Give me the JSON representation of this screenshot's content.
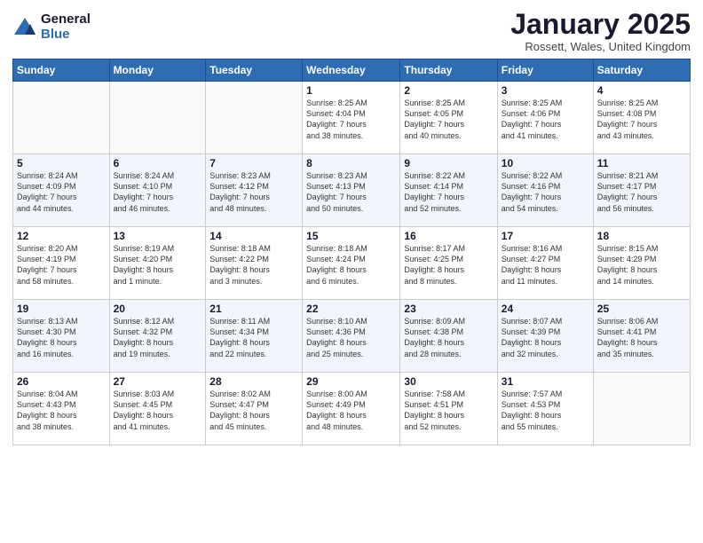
{
  "logo": {
    "general": "General",
    "blue": "Blue"
  },
  "title": "January 2025",
  "location": "Rossett, Wales, United Kingdom",
  "days_of_week": [
    "Sunday",
    "Monday",
    "Tuesday",
    "Wednesday",
    "Thursday",
    "Friday",
    "Saturday"
  ],
  "weeks": [
    [
      {
        "day": "",
        "info": ""
      },
      {
        "day": "",
        "info": ""
      },
      {
        "day": "",
        "info": ""
      },
      {
        "day": "1",
        "info": "Sunrise: 8:25 AM\nSunset: 4:04 PM\nDaylight: 7 hours\nand 38 minutes."
      },
      {
        "day": "2",
        "info": "Sunrise: 8:25 AM\nSunset: 4:05 PM\nDaylight: 7 hours\nand 40 minutes."
      },
      {
        "day": "3",
        "info": "Sunrise: 8:25 AM\nSunset: 4:06 PM\nDaylight: 7 hours\nand 41 minutes."
      },
      {
        "day": "4",
        "info": "Sunrise: 8:25 AM\nSunset: 4:08 PM\nDaylight: 7 hours\nand 43 minutes."
      }
    ],
    [
      {
        "day": "5",
        "info": "Sunrise: 8:24 AM\nSunset: 4:09 PM\nDaylight: 7 hours\nand 44 minutes."
      },
      {
        "day": "6",
        "info": "Sunrise: 8:24 AM\nSunset: 4:10 PM\nDaylight: 7 hours\nand 46 minutes."
      },
      {
        "day": "7",
        "info": "Sunrise: 8:23 AM\nSunset: 4:12 PM\nDaylight: 7 hours\nand 48 minutes."
      },
      {
        "day": "8",
        "info": "Sunrise: 8:23 AM\nSunset: 4:13 PM\nDaylight: 7 hours\nand 50 minutes."
      },
      {
        "day": "9",
        "info": "Sunrise: 8:22 AM\nSunset: 4:14 PM\nDaylight: 7 hours\nand 52 minutes."
      },
      {
        "day": "10",
        "info": "Sunrise: 8:22 AM\nSunset: 4:16 PM\nDaylight: 7 hours\nand 54 minutes."
      },
      {
        "day": "11",
        "info": "Sunrise: 8:21 AM\nSunset: 4:17 PM\nDaylight: 7 hours\nand 56 minutes."
      }
    ],
    [
      {
        "day": "12",
        "info": "Sunrise: 8:20 AM\nSunset: 4:19 PM\nDaylight: 7 hours\nand 58 minutes."
      },
      {
        "day": "13",
        "info": "Sunrise: 8:19 AM\nSunset: 4:20 PM\nDaylight: 8 hours\nand 1 minute."
      },
      {
        "day": "14",
        "info": "Sunrise: 8:18 AM\nSunset: 4:22 PM\nDaylight: 8 hours\nand 3 minutes."
      },
      {
        "day": "15",
        "info": "Sunrise: 8:18 AM\nSunset: 4:24 PM\nDaylight: 8 hours\nand 6 minutes."
      },
      {
        "day": "16",
        "info": "Sunrise: 8:17 AM\nSunset: 4:25 PM\nDaylight: 8 hours\nand 8 minutes."
      },
      {
        "day": "17",
        "info": "Sunrise: 8:16 AM\nSunset: 4:27 PM\nDaylight: 8 hours\nand 11 minutes."
      },
      {
        "day": "18",
        "info": "Sunrise: 8:15 AM\nSunset: 4:29 PM\nDaylight: 8 hours\nand 14 minutes."
      }
    ],
    [
      {
        "day": "19",
        "info": "Sunrise: 8:13 AM\nSunset: 4:30 PM\nDaylight: 8 hours\nand 16 minutes."
      },
      {
        "day": "20",
        "info": "Sunrise: 8:12 AM\nSunset: 4:32 PM\nDaylight: 8 hours\nand 19 minutes."
      },
      {
        "day": "21",
        "info": "Sunrise: 8:11 AM\nSunset: 4:34 PM\nDaylight: 8 hours\nand 22 minutes."
      },
      {
        "day": "22",
        "info": "Sunrise: 8:10 AM\nSunset: 4:36 PM\nDaylight: 8 hours\nand 25 minutes."
      },
      {
        "day": "23",
        "info": "Sunrise: 8:09 AM\nSunset: 4:38 PM\nDaylight: 8 hours\nand 28 minutes."
      },
      {
        "day": "24",
        "info": "Sunrise: 8:07 AM\nSunset: 4:39 PM\nDaylight: 8 hours\nand 32 minutes."
      },
      {
        "day": "25",
        "info": "Sunrise: 8:06 AM\nSunset: 4:41 PM\nDaylight: 8 hours\nand 35 minutes."
      }
    ],
    [
      {
        "day": "26",
        "info": "Sunrise: 8:04 AM\nSunset: 4:43 PM\nDaylight: 8 hours\nand 38 minutes."
      },
      {
        "day": "27",
        "info": "Sunrise: 8:03 AM\nSunset: 4:45 PM\nDaylight: 8 hours\nand 41 minutes."
      },
      {
        "day": "28",
        "info": "Sunrise: 8:02 AM\nSunset: 4:47 PM\nDaylight: 8 hours\nand 45 minutes."
      },
      {
        "day": "29",
        "info": "Sunrise: 8:00 AM\nSunset: 4:49 PM\nDaylight: 8 hours\nand 48 minutes."
      },
      {
        "day": "30",
        "info": "Sunrise: 7:58 AM\nSunset: 4:51 PM\nDaylight: 8 hours\nand 52 minutes."
      },
      {
        "day": "31",
        "info": "Sunrise: 7:57 AM\nSunset: 4:53 PM\nDaylight: 8 hours\nand 55 minutes."
      },
      {
        "day": "",
        "info": ""
      }
    ]
  ]
}
